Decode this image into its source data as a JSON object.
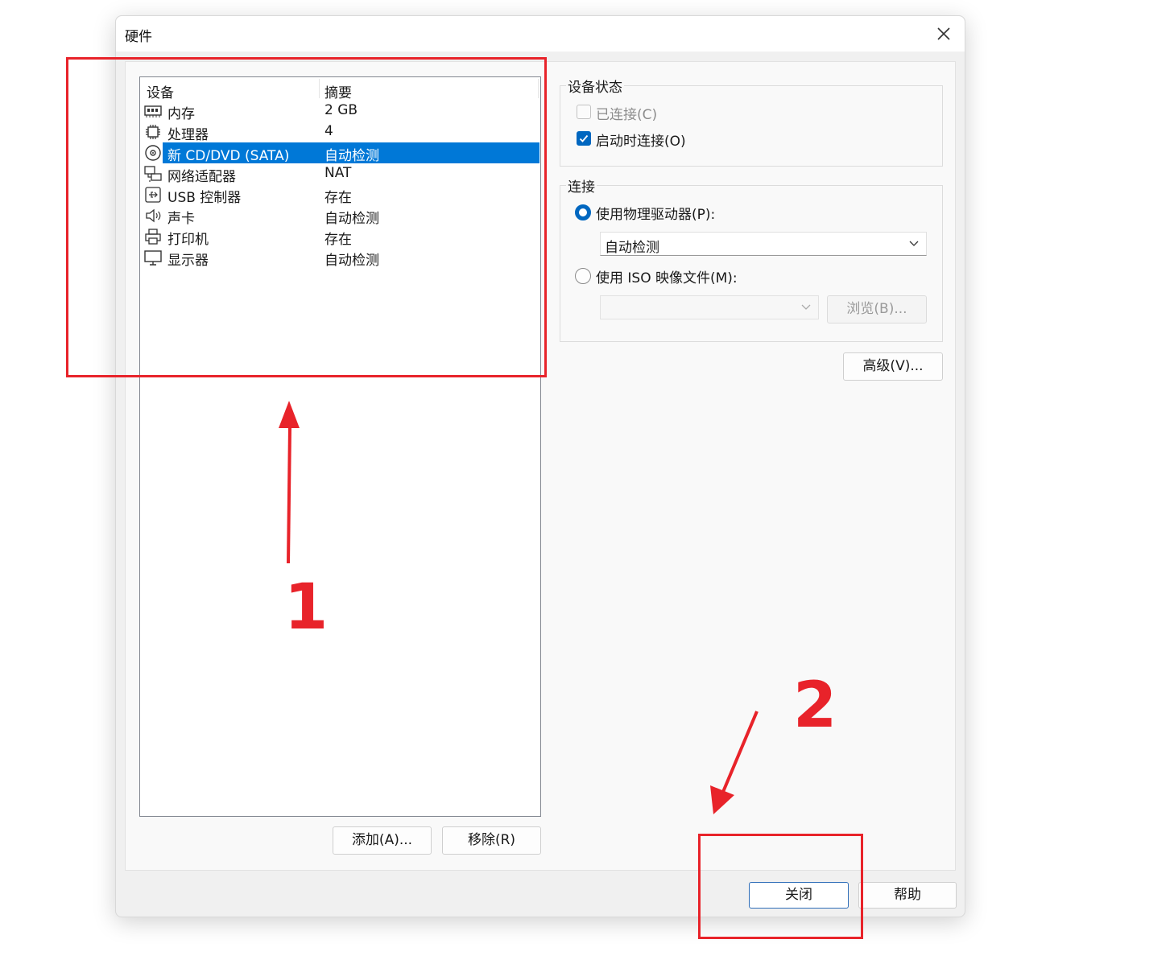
{
  "window": {
    "title": "硬件",
    "close_icon": "close-icon"
  },
  "devices": {
    "headers": {
      "device": "设备",
      "summary": "摘要"
    },
    "items": [
      {
        "name": "内存",
        "summary": "2 GB",
        "icon": "memory-icon",
        "selected": false
      },
      {
        "name": "处理器",
        "summary": "4",
        "icon": "processor-icon",
        "selected": false
      },
      {
        "name": "新 CD/DVD (SATA)",
        "summary": "自动检测",
        "icon": "cd-dvd-icon",
        "selected": true
      },
      {
        "name": "网络适配器",
        "summary": "NAT",
        "icon": "network-adapter-icon",
        "selected": false
      },
      {
        "name": "USB 控制器",
        "summary": "存在",
        "icon": "usb-icon",
        "selected": false
      },
      {
        "name": "声卡",
        "summary": "自动检测",
        "icon": "sound-icon",
        "selected": false
      },
      {
        "name": "打印机",
        "summary": "存在",
        "icon": "printer-icon",
        "selected": false
      },
      {
        "name": "显示器",
        "summary": "自动检测",
        "icon": "monitor-icon",
        "selected": false
      }
    ],
    "add_button": "添加(A)...",
    "remove_button": "移除(R)"
  },
  "device_status": {
    "label": "设备状态",
    "connected": {
      "label": "已连接(C)",
      "checked": false,
      "enabled": false
    },
    "connect_at_power_on": {
      "label": "启动时连接(O)",
      "checked": true,
      "enabled": true
    }
  },
  "connection": {
    "label": "连接",
    "physical_drive": {
      "label": "使用物理驱动器(P):",
      "selected": true,
      "value": "自动检测"
    },
    "iso_image": {
      "label": "使用 ISO 映像文件(M):",
      "selected": false,
      "value": ""
    },
    "browse_button": "浏览(B)..."
  },
  "advanced_button": "高级(V)...",
  "footer": {
    "close_button": "关闭",
    "help_button": "帮助"
  },
  "annotations": {
    "marker_1": "1",
    "marker_2": "2",
    "color": "#e8232a"
  },
  "colors": {
    "selection": "#0078d7",
    "accent": "#0067c0"
  }
}
